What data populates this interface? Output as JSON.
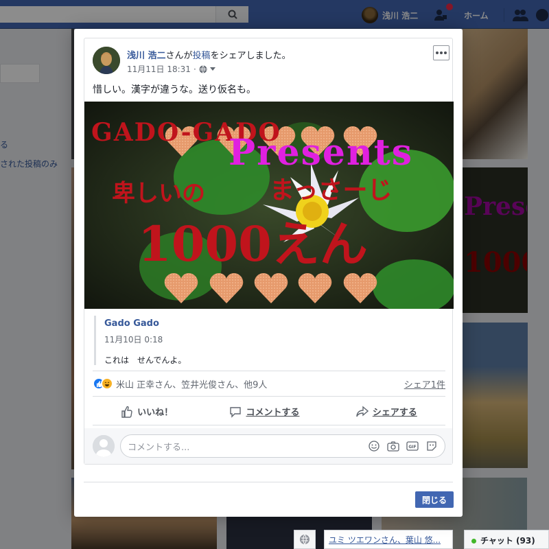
{
  "topbar": {
    "user_name": "浅川 浩二",
    "home_label": "ホーム"
  },
  "left_column": {
    "link_1": "る",
    "link_2": "された投稿のみ"
  },
  "post": {
    "author": "浅川 浩二",
    "verb_prefix": "さんが",
    "verb_link": "投稿",
    "verb_suffix": "をシェアしました。",
    "timestamp": "11月11日 18:31",
    "privacy_separator": "·",
    "text": "惜しい。漢字が違うな。送り仮名も。",
    "image": {
      "line_gado": "GADO-GADO",
      "line_presents": "Presents",
      "line_hiku": "卑しいの",
      "line_massage": "まっさーじ",
      "line_price": "1000えん"
    },
    "shared": {
      "name": "Gado Gado",
      "time": "11月10日 0:18",
      "text": "これは　せんでんよ。"
    },
    "reactions_names": "米山 正幸さん、笠井光俊さん、他9人",
    "share_count": "シェア1件",
    "actions": {
      "like": "いいね！",
      "comment": "コメントする",
      "share": "シェアする"
    },
    "comment_placeholder": "コメントする..."
  },
  "modal": {
    "close_label": "閉じる"
  },
  "chat": {
    "friends_preview": "ユミ ツエワンさん、葉山 悠...",
    "chat_label": "チャット (93)"
  },
  "colors": {
    "facebook_blue": "#4267b2",
    "link_blue": "#365899",
    "image_red": "#c0141c",
    "image_magenta": "#e020e0"
  }
}
